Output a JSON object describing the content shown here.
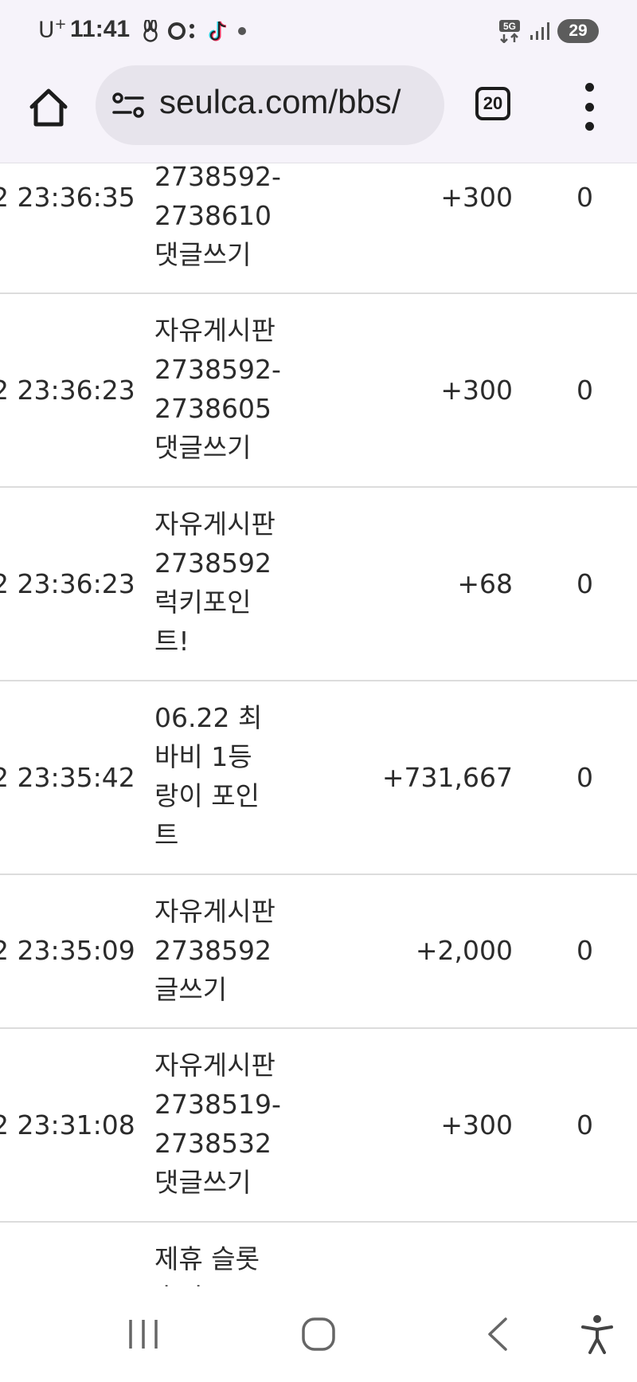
{
  "status_bar": {
    "carrier": "U",
    "carrier_sup": "+",
    "time": "11:41",
    "network": "5G",
    "battery": "29"
  },
  "browser": {
    "url": "seulca.com/bbs/",
    "tab_count": "20"
  },
  "rows": [
    {
      "time": "2 23:36:35",
      "desc": [
        "2738592-",
        "2738610",
        "댓글쓰기"
      ],
      "points": "+300",
      "balance": "0"
    },
    {
      "time": "2 23:36:23",
      "desc": [
        "자유게시판",
        "2738592-",
        "2738605",
        "댓글쓰기"
      ],
      "points": "+300",
      "balance": "0"
    },
    {
      "time": "2 23:36:23",
      "desc": [
        "자유게시판",
        "2738592",
        "럭키포인",
        "트!"
      ],
      "points": "+68",
      "balance": "0"
    },
    {
      "time": "2 23:35:42",
      "desc": [
        "06.22 최",
        "바비 1등",
        "랑이 포인",
        "트"
      ],
      "points": "+731,667",
      "balance": "0"
    },
    {
      "time": "2 23:35:09",
      "desc": [
        "자유게시판",
        "2738592",
        "글쓰기"
      ],
      "points": "+2,000",
      "balance": "0"
    },
    {
      "time": "2 23:31:08",
      "desc": [
        "자유게시판",
        "2738519-",
        "2738532",
        "댓글쓰기"
      ],
      "points": "+300",
      "balance": "0"
    },
    {
      "time": "",
      "desc": [
        "제휴 슬롯",
        "후기"
      ],
      "points": "",
      "balance": ""
    }
  ]
}
